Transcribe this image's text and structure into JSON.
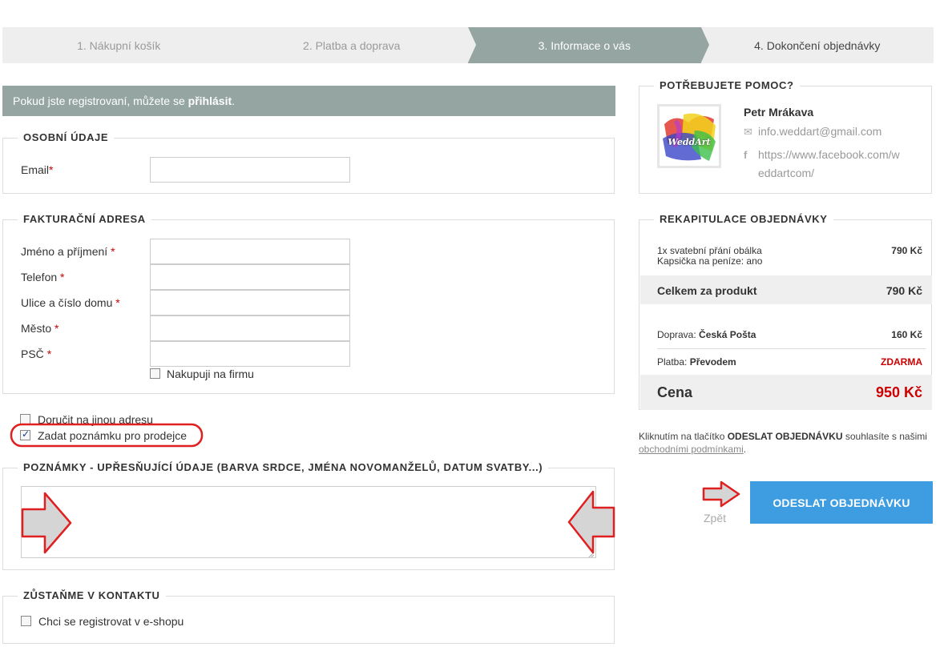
{
  "steps": [
    {
      "label": "1. Nákupní košík"
    },
    {
      "label": "2. Platba a doprava"
    },
    {
      "label": "3. Informace o vás"
    },
    {
      "label": "4. Dokončení objednávky"
    }
  ],
  "login": {
    "text": "Pokud jste registrovaní, můžete se ",
    "link": "přihlásit",
    "suffix": "."
  },
  "personal": {
    "legend": "OSOBNÍ ÚDAJE",
    "email_label": "Email",
    "req": "*",
    "email_value": ""
  },
  "billing": {
    "legend": "FAKTURAČNÍ ADRESA",
    "fields": [
      {
        "label": "Jméno a příjmení",
        "req": "*",
        "value": ""
      },
      {
        "label": "Telefon",
        "req": "*",
        "value": ""
      },
      {
        "label": "Ulice a číslo domu",
        "req": "*",
        "value": ""
      },
      {
        "label": "Město",
        "req": "*",
        "value": ""
      },
      {
        "label": "PSČ",
        "req": "*",
        "value": ""
      }
    ],
    "company_label": "Nakupuji na firmu"
  },
  "options": {
    "other_address": "Doručit na jinou adresu",
    "seller_note": "Zadat poznámku pro prodejce"
  },
  "notes": {
    "legend": "POZNÁMKY - UPŘESŇUJÍCÍ ÚDAJE (BARVA SRDCE, JMÉNA NOVOMANŽELŮ, DATUM SVATBY...)",
    "value": ""
  },
  "contact": {
    "legend": "ZŮSTAŇME V KONTAKTU",
    "register_label": "Chci se registrovat v e-shopu"
  },
  "help": {
    "legend": "POTŘEBUJETE POMOC?",
    "name": "Petr Mrákava",
    "email": "info.weddart@gmail.com",
    "facebook_line1": "https://www.facebook.com/w",
    "facebook_line2": "eddartcom/",
    "logo_text": "WeddArt"
  },
  "summary": {
    "legend": "REKAPITULACE OBJEDNÁVKY",
    "item_title": "1x svatební přání obálka",
    "item_option": "Kapsička na peníze: ano",
    "item_price": "790 Kč",
    "product_total_label": "Celkem za produkt",
    "product_total_value": "790 Kč",
    "shipping_label": "Doprava:",
    "shipping_method": "Česká Pošta",
    "shipping_price": "160 Kč",
    "payment_label": "Platba:",
    "payment_method": "Převodem",
    "payment_price": "ZDARMA",
    "total_label": "Cena",
    "total_value": "950 Kč"
  },
  "agreement": {
    "pre": "Kliknutím na tlačítko ",
    "button_name": "ODESLAT OBJEDNÁVKU",
    "mid": " souhlasíte s našimi ",
    "link": "obchodními podmínkami",
    "post": "."
  },
  "actions": {
    "back": "Zpět",
    "submit": "ODESLAT OBJEDNÁVKU"
  },
  "colors": {
    "step_active": "#95a5a2",
    "submit": "#3d9de0",
    "price_red": "#cc0000",
    "annotation_red": "#e02020"
  }
}
